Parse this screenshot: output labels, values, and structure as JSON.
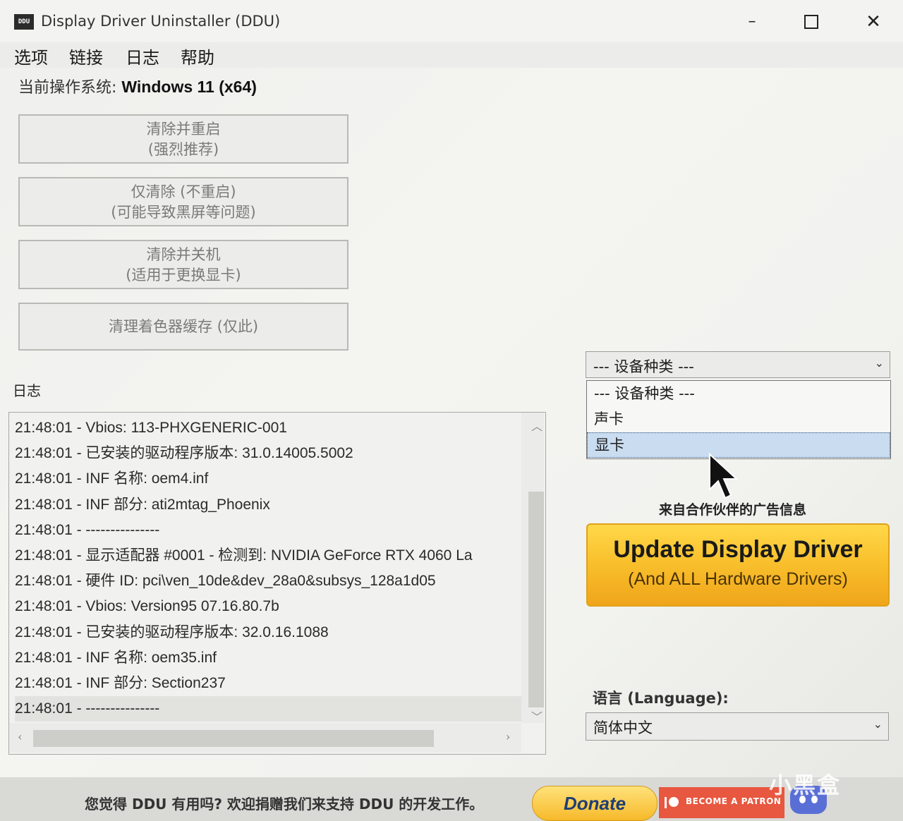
{
  "window": {
    "title": "Display Driver Uninstaller (DDU)",
    "icon_text": "DDU",
    "controls": {
      "minimize": "–",
      "close": "✕"
    }
  },
  "menu": [
    "选项",
    "链接",
    "日志",
    "帮助"
  ],
  "os": {
    "label": "当前操作系统: ",
    "value": "Windows 11 (x64)"
  },
  "actions": [
    {
      "line1": "清除并重启",
      "line2": "(强烈推荐)"
    },
    {
      "line1": "仅清除 (不重启)",
      "line2": "(可能导致黑屏等问题)"
    },
    {
      "line1": "清除并关机",
      "line2": "(适用于更换显卡)"
    },
    {
      "line1": "清理着色器缓存 (仅此)"
    }
  ],
  "log": {
    "label": "日志",
    "lines": [
      "21:48:01 - Vbios: 113-PHXGENERIC-001",
      "21:48:01 - 已安装的驱动程序版本: 31.0.14005.5002",
      "21:48:01 - INF 名称: oem4.inf",
      "21:48:01 - INF 部分: ati2mtag_Phoenix",
      "21:48:01 - ---------------",
      "21:48:01 - 显示适配器 #0001 - 检测到: NVIDIA GeForce RTX 4060 La",
      "21:48:01 - 硬件 ID: pci\\ven_10de&dev_28a0&subsys_128a1d05",
      "21:48:01 - Vbios: Version95 07.16.80.7b",
      "21:48:01 - 已安装的驱动程序版本: 32.0.16.1088",
      "21:48:01 - INF 名称: oem35.inf",
      "21:48:01 - INF 部分: Section237",
      "21:48:01 - ---------------"
    ]
  },
  "device_type": {
    "selected": "--- 设备种类 ---",
    "options": [
      "--- 设备种类 ---",
      "声卡",
      "显卡"
    ],
    "highlighted": "显卡"
  },
  "ad": {
    "caption": "来自合作伙伴的广告信息",
    "title": "Update Display Driver",
    "subtitle": "(And ALL Hardware Drivers)"
  },
  "language": {
    "label": "语言 (Language):",
    "value": "简体中文"
  },
  "footer": {
    "text": "您觉得 DDU 有用吗? 欢迎捐赠我们来支持 DDU 的开发工作。",
    "donate": "Donate",
    "patron": "BECOME A PATRON"
  },
  "watermark": "小黑盒",
  "colors": {
    "ad_gold": "#f9c12d",
    "highlight": "#c9dcf0",
    "patron": "#e8573f",
    "discord": "#5a6fd6"
  }
}
